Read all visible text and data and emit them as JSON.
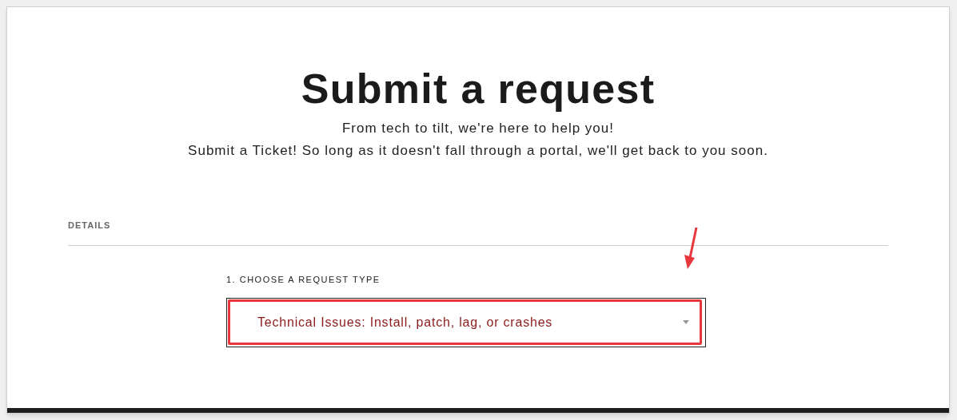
{
  "header": {
    "title": "Submit a request",
    "subtitle_lines": [
      "From tech to tilt, we're here to help you!",
      "Submit a Ticket! So long as it doesn't fall through a portal, we'll get back to you soon."
    ]
  },
  "section": {
    "heading": "DETAILS"
  },
  "request_type": {
    "label": "1. CHOOSE A REQUEST TYPE",
    "value": "Technical Issues: Install, patch, lag, or crashes",
    "highlighted": true
  }
}
